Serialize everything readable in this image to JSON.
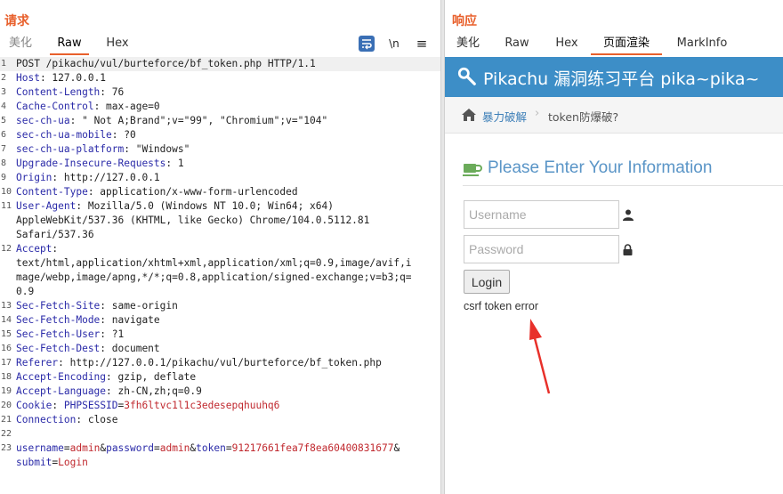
{
  "request": {
    "title": "请求",
    "tabs": [
      "美化",
      "Raw",
      "Hex"
    ],
    "toolbar": {
      "newline_label": "\\n",
      "menu_label": "≡"
    },
    "lines": [
      {
        "n": "1",
        "parts": [
          {
            "t": "POST /pikachu/vul/burteforce/bf_token.php HTTP/1.1",
            "c": "v"
          }
        ]
      },
      {
        "n": "2",
        "parts": [
          {
            "t": "Host",
            "c": "k"
          },
          {
            "t": ": 127.0.0.1",
            "c": "v"
          }
        ]
      },
      {
        "n": "3",
        "parts": [
          {
            "t": "Content-Length",
            "c": "k"
          },
          {
            "t": ": 76",
            "c": "v"
          }
        ]
      },
      {
        "n": "4",
        "parts": [
          {
            "t": "Cache-Control",
            "c": "k"
          },
          {
            "t": ": max-age=0",
            "c": "v"
          }
        ]
      },
      {
        "n": "5",
        "parts": [
          {
            "t": "sec-ch-ua",
            "c": "k"
          },
          {
            "t": ": \" Not A;Brand\";v=\"99\", \"Chromium\";v=\"104\"",
            "c": "v"
          }
        ]
      },
      {
        "n": "6",
        "parts": [
          {
            "t": "sec-ch-ua-mobile",
            "c": "k"
          },
          {
            "t": ": ?0",
            "c": "v"
          }
        ]
      },
      {
        "n": "7",
        "parts": [
          {
            "t": "sec-ch-ua-platform",
            "c": "k"
          },
          {
            "t": ": \"Windows\"",
            "c": "v"
          }
        ]
      },
      {
        "n": "8",
        "parts": [
          {
            "t": "Upgrade-Insecure-Requests",
            "c": "k"
          },
          {
            "t": ": 1",
            "c": "v"
          }
        ]
      },
      {
        "n": "9",
        "parts": [
          {
            "t": "Origin",
            "c": "k"
          },
          {
            "t": ": http://127.0.0.1",
            "c": "v"
          }
        ]
      },
      {
        "n": "10",
        "parts": [
          {
            "t": "Content-Type",
            "c": "k"
          },
          {
            "t": ": application/x-www-form-urlencoded",
            "c": "v"
          }
        ]
      },
      {
        "n": "11",
        "parts": [
          {
            "t": "User-Agent",
            "c": "k"
          },
          {
            "t": ": Mozilla/5.0 (Windows NT 10.0; Win64; x64)",
            "c": "v"
          }
        ]
      },
      {
        "n": "",
        "parts": [
          {
            "t": "AppleWebKit/537.36 (KHTML, like Gecko) Chrome/104.0.5112.81",
            "c": "v"
          }
        ]
      },
      {
        "n": "",
        "parts": [
          {
            "t": "Safari/537.36",
            "c": "v"
          }
        ]
      },
      {
        "n": "12",
        "parts": [
          {
            "t": "Accept",
            "c": "k"
          },
          {
            "t": ":",
            "c": "v"
          }
        ]
      },
      {
        "n": "",
        "parts": [
          {
            "t": "text/html,application/xhtml+xml,application/xml;q=0.9,image/avif,i",
            "c": "v"
          }
        ]
      },
      {
        "n": "",
        "parts": [
          {
            "t": "mage/webp,image/apng,*/*;q=0.8,application/signed-exchange;v=b3;q=",
            "c": "v"
          }
        ]
      },
      {
        "n": "",
        "parts": [
          {
            "t": "0.9",
            "c": "v"
          }
        ]
      },
      {
        "n": "13",
        "parts": [
          {
            "t": "Sec-Fetch-Site",
            "c": "k"
          },
          {
            "t": ": same-origin",
            "c": "v"
          }
        ]
      },
      {
        "n": "14",
        "parts": [
          {
            "t": "Sec-Fetch-Mode",
            "c": "k"
          },
          {
            "t": ": navigate",
            "c": "v"
          }
        ]
      },
      {
        "n": "15",
        "parts": [
          {
            "t": "Sec-Fetch-User",
            "c": "k"
          },
          {
            "t": ": ?1",
            "c": "v"
          }
        ]
      },
      {
        "n": "16",
        "parts": [
          {
            "t": "Sec-Fetch-Dest",
            "c": "k"
          },
          {
            "t": ": document",
            "c": "v"
          }
        ]
      },
      {
        "n": "17",
        "parts": [
          {
            "t": "Referer",
            "c": "k"
          },
          {
            "t": ": http://127.0.0.1/pikachu/vul/burteforce/bf_token.php",
            "c": "v"
          }
        ]
      },
      {
        "n": "18",
        "parts": [
          {
            "t": "Accept-Encoding",
            "c": "k"
          },
          {
            "t": ": gzip, deflate",
            "c": "v"
          }
        ]
      },
      {
        "n": "19",
        "parts": [
          {
            "t": "Accept-Language",
            "c": "k"
          },
          {
            "t": ": zh-CN,zh;q=0.9",
            "c": "v"
          }
        ]
      },
      {
        "n": "20",
        "parts": [
          {
            "t": "Cookie",
            "c": "k"
          },
          {
            "t": ": ",
            "c": "v"
          },
          {
            "t": "PHPSESSID",
            "c": "k"
          },
          {
            "t": "=",
            "c": "v"
          },
          {
            "t": "3fh6ltvc1l1c3edesepqhuuhq6",
            "c": "p"
          }
        ]
      },
      {
        "n": "21",
        "parts": [
          {
            "t": "Connection",
            "c": "k"
          },
          {
            "t": ": close",
            "c": "v"
          }
        ]
      },
      {
        "n": "22",
        "parts": [
          {
            "t": "",
            "c": "v"
          }
        ]
      },
      {
        "n": "23",
        "parts": [
          {
            "t": "username",
            "c": "k"
          },
          {
            "t": "=",
            "c": "v"
          },
          {
            "t": "admin",
            "c": "p"
          },
          {
            "t": "&",
            "c": "v"
          },
          {
            "t": "password",
            "c": "k"
          },
          {
            "t": "=",
            "c": "v"
          },
          {
            "t": "admin",
            "c": "p"
          },
          {
            "t": "&",
            "c": "v"
          },
          {
            "t": "token",
            "c": "k"
          },
          {
            "t": "=",
            "c": "v"
          },
          {
            "t": "91217661fea7f8ea60400831677",
            "c": "p"
          },
          {
            "t": "&",
            "c": "v"
          }
        ]
      },
      {
        "n": "",
        "parts": [
          {
            "t": "submit",
            "c": "k"
          },
          {
            "t": "=",
            "c": "v"
          },
          {
            "t": "Login",
            "c": "p"
          }
        ]
      }
    ]
  },
  "response": {
    "title": "响应",
    "tabs": [
      "美化",
      "Raw",
      "Hex",
      "页面渲染",
      "MarkInfo"
    ],
    "site_title": "Pikachu 漏洞练习平台 pika~pika~",
    "breadcrumb": {
      "item1": "暴力破解",
      "separator": "›",
      "item2": "token防爆破?"
    },
    "form_heading": "Please Enter Your Information",
    "username_placeholder": "Username",
    "password_placeholder": "Password",
    "login_label": "Login",
    "error_text": "csrf token error"
  },
  "colors": {
    "accent": "#e8602c",
    "header_blue": "#3d8ec7",
    "arrow_red": "#e8302a",
    "key_blue": "#2a2aa8",
    "value_red": "#c0282e"
  }
}
